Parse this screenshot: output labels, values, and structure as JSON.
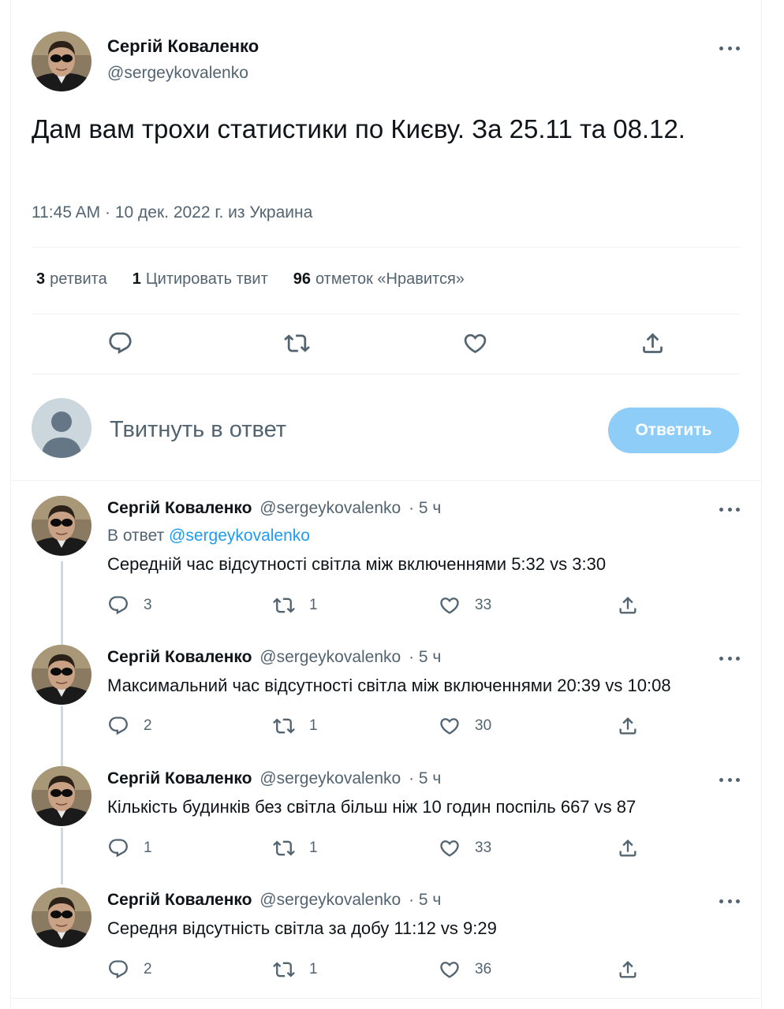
{
  "main_tweet": {
    "author": "Сергій Коваленко",
    "handle": "@sergeykovalenko",
    "text": "Дам вам трохи статистики по Києву. За 25.11 та 08.12.",
    "meta": "11:45 AM · 10 дек. 2022 г. из Украина",
    "stats": {
      "retweets_count": "3",
      "retweets_label": "ретвита",
      "quotes_count": "1",
      "quotes_label": "Цитировать твит",
      "likes_count": "96",
      "likes_label": "отметок «Нравится»"
    }
  },
  "reply_box": {
    "placeholder": "Твитнуть в ответ",
    "button": "Ответить"
  },
  "replies": [
    {
      "author": "Сергій Коваленко",
      "handle": "@sergeykovalenko",
      "time": "· 5 ч",
      "reply_to_label": "В ответ",
      "reply_to_handle": "@sergeykovalenko",
      "text": "Середній час відсутності світла між включеннями 5:32 vs 3:30",
      "replies": "3",
      "retweets": "1",
      "likes": "33"
    },
    {
      "author": "Сергій Коваленко",
      "handle": "@sergeykovalenko",
      "time": "· 5 ч",
      "text": "Максимальний час відсутності світла між включеннями 20:39 vs 10:08",
      "replies": "2",
      "retweets": "1",
      "likes": "30"
    },
    {
      "author": "Сергій Коваленко",
      "handle": "@sergeykovalenko",
      "time": "· 5 ч",
      "text": "Кількість будинків без світла більш ніж 10 годин поспіль 667 vs  87",
      "replies": "1",
      "retweets": "1",
      "likes": "33"
    },
    {
      "author": "Сергій Коваленко",
      "handle": "@sergeykovalenko",
      "time": "· 5 ч",
      "text": "Середня відсутність світла за  добу 11:12 vs 9:29",
      "replies": "2",
      "retweets": "1",
      "likes": "36"
    }
  ],
  "colors": {
    "accent": "#1d9bf0",
    "reply_button_disabled": "#8ecdf8",
    "secondary_text": "#536471",
    "divider": "#eff3f4"
  }
}
